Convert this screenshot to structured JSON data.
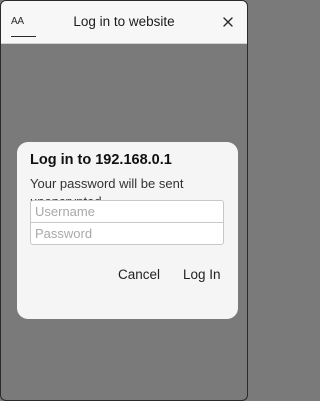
{
  "header": {
    "text_size_label": "AA",
    "title": "Log in to website",
    "close_icon": "close-icon"
  },
  "dialog": {
    "title": "Log in to 192.168.0.1",
    "message": "Your password will be sent unencrypted.",
    "username": {
      "placeholder": "Username",
      "value": ""
    },
    "password": {
      "placeholder": "Password",
      "value": ""
    },
    "cancel_label": "Cancel",
    "login_label": "Log In"
  },
  "colors": {
    "backdrop": "#7a7a7a",
    "header_bg": "#f7f7f7",
    "dialog_bg": "#f5f5f5"
  }
}
